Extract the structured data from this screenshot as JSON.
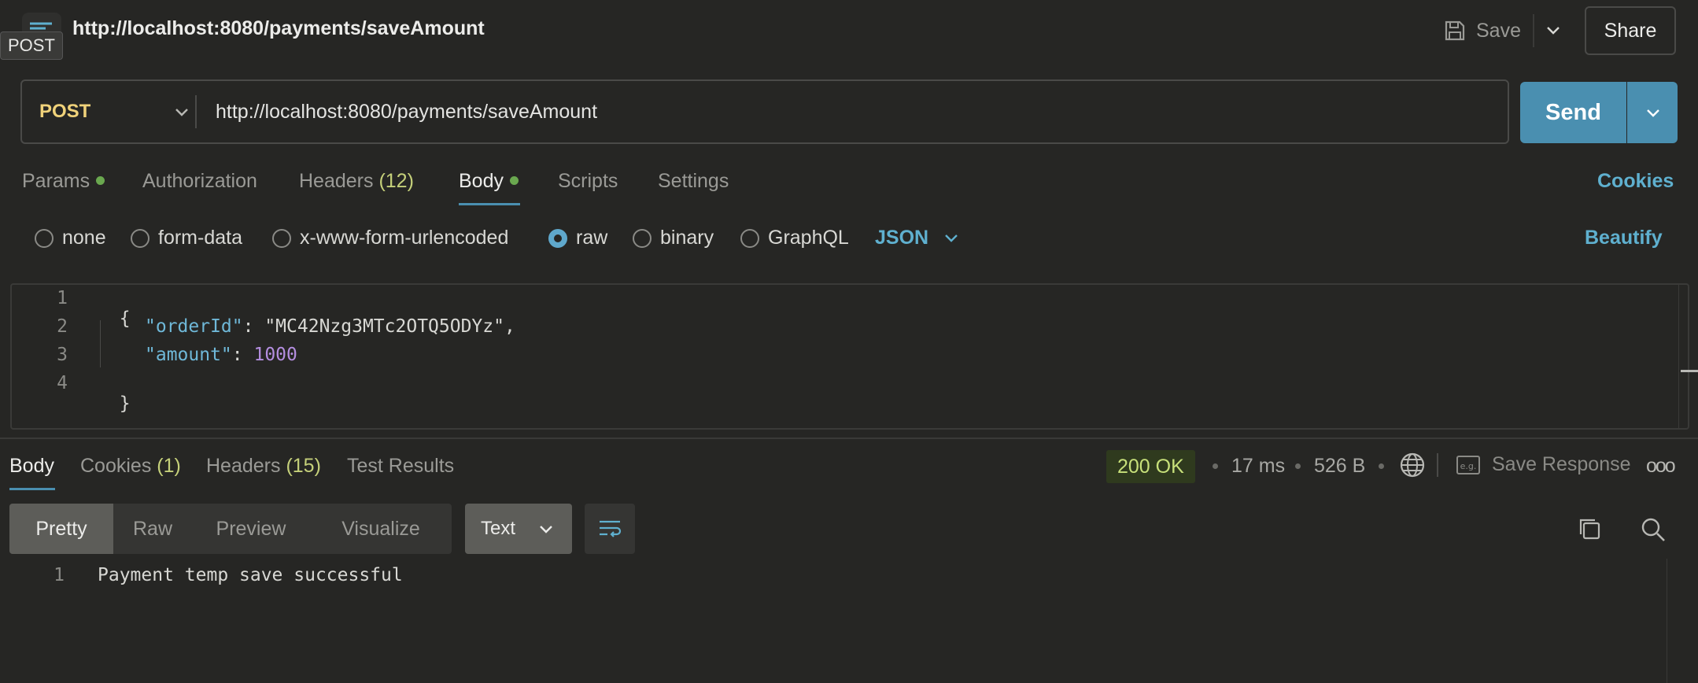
{
  "tab": {
    "method_tooltip": "POST",
    "title": "http://localhost:8080/payments/saveAmount"
  },
  "toolbar": {
    "save_label": "Save",
    "share_label": "Share"
  },
  "request": {
    "method": "POST",
    "url": "http://localhost:8080/payments/saveAmount",
    "send_label": "Send"
  },
  "request_tabs": {
    "params": "Params",
    "authorization": "Authorization",
    "headers": "Headers",
    "headers_count": "(12)",
    "body": "Body",
    "scripts": "Scripts",
    "settings": "Settings",
    "cookies": "Cookies"
  },
  "body_options": {
    "none": "none",
    "form_data": "form-data",
    "urlencoded": "x-www-form-urlencoded",
    "raw": "raw",
    "binary": "binary",
    "graphql": "GraphQL",
    "selected": "raw",
    "language": "JSON",
    "beautify": "Beautify"
  },
  "request_body": {
    "line_numbers": [
      "1",
      "2",
      "3",
      "4"
    ],
    "open_brace": "{",
    "key1": "\"orderId\"",
    "val1": "\"MC42Nzg3MTc2OTQ5ODYz\"",
    "key2": "\"amount\"",
    "val2": "1000",
    "colon": ": ",
    "comma": ",",
    "close_brace": "}"
  },
  "response_tabs": {
    "body": "Body",
    "cookies": "Cookies",
    "cookies_count": "(1)",
    "headers": "Headers",
    "headers_count": "(15)",
    "test_results": "Test Results"
  },
  "response_meta": {
    "status": "200 OK",
    "time": "17 ms",
    "size": "526 B",
    "save_response": "Save Response",
    "more": "ooo"
  },
  "response_view": {
    "modes": [
      "Pretty",
      "Raw",
      "Preview",
      "Visualize"
    ],
    "active_mode": "Pretty",
    "format": "Text"
  },
  "response_body": {
    "line_number": "1",
    "text": "Payment temp save successful"
  },
  "colors": {
    "background": "#262624",
    "accent": "#4a8fb0",
    "link": "#5fb0cf",
    "method": "#f0d27a",
    "status_ok": "#c7e07a",
    "dot": "#6aa84f"
  }
}
